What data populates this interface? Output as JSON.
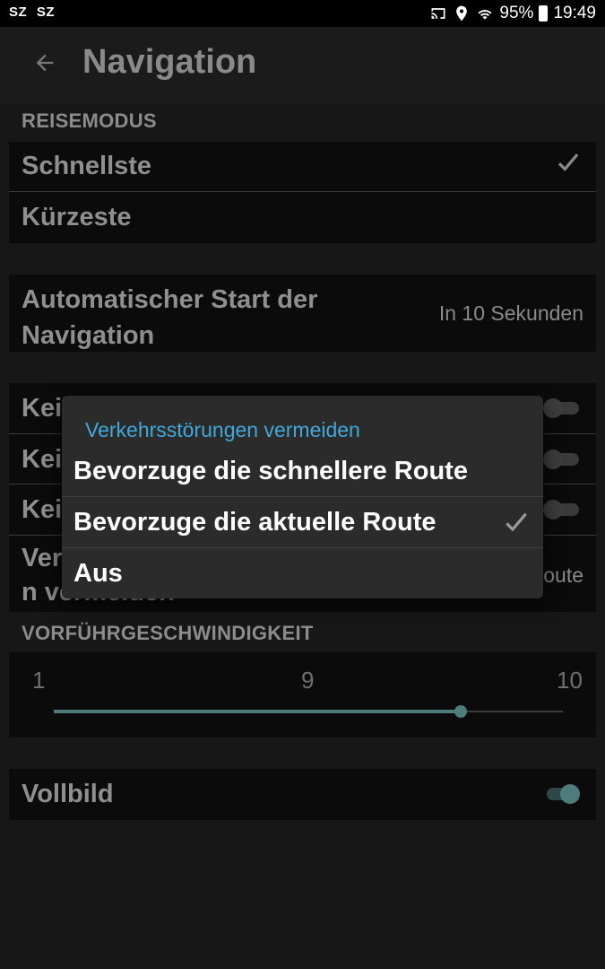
{
  "status_bar": {
    "left_icons": [
      "SZ",
      "SZ"
    ],
    "battery": "95%",
    "time": "19:49"
  },
  "header": {
    "title": "Navigation"
  },
  "travel_mode": {
    "header": "REISEMODUS",
    "options": [
      {
        "label": "Schnellste",
        "selected": true
      },
      {
        "label": "Kürzeste",
        "selected": false
      }
    ]
  },
  "auto_start": {
    "label_line1": "Automatischer Start der",
    "label_line2": "Navigation",
    "value": "In 10 Sekunden"
  },
  "avoid_rows": [
    {
      "label": "Kei",
      "on": false
    },
    {
      "label": "Kei",
      "on": false
    },
    {
      "label": "Kei",
      "on": false
    }
  ],
  "traffic_row": {
    "label_line1": "Ver",
    "label_line2": "n vermeiden",
    "value_partial": "oute"
  },
  "demo_speed": {
    "header": "VORFÜHRGESCHWINDIGKEIT",
    "min_label": "1",
    "current_label": "9",
    "max_label": "10",
    "value": 9,
    "min": 1,
    "max": 10
  },
  "fullscreen": {
    "label": "Vollbild",
    "on": true
  },
  "dialog": {
    "title": "Verkehrsstörungen vermeiden",
    "options": [
      {
        "label": "Bevorzuge die schnellere Route",
        "selected": false
      },
      {
        "label": "Bevorzuge die aktuelle Route",
        "selected": true
      },
      {
        "label": "Aus",
        "selected": false
      }
    ]
  },
  "colors": {
    "accent": "#3fa9d9",
    "slider": "#4e7b7c",
    "dialog_bg": "#2b2b2b"
  }
}
